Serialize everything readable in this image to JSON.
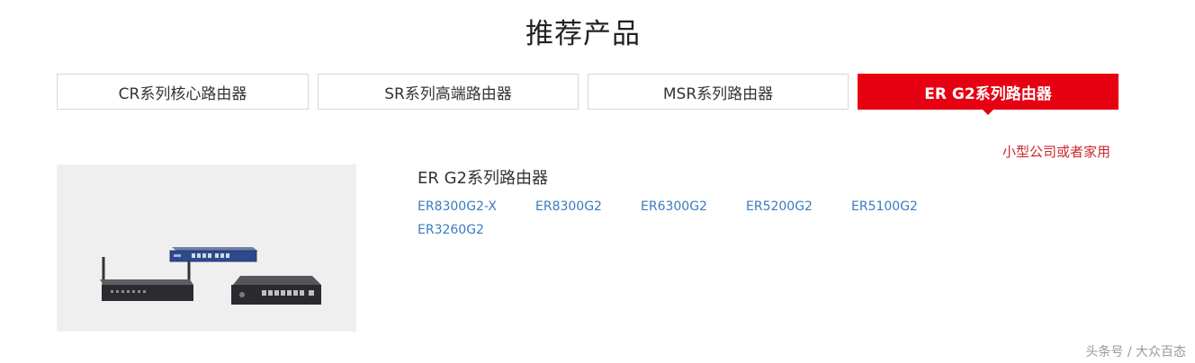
{
  "section": {
    "title": "推荐产品"
  },
  "tabs": [
    {
      "label": "CR系列核心路由器",
      "active": false
    },
    {
      "label": "SR系列高端路由器",
      "active": false
    },
    {
      "label": "MSR系列路由器",
      "active": false
    },
    {
      "label": "ER G2系列路由器",
      "active": true
    }
  ],
  "active_tab_subtitle": "小型公司或者家用",
  "product": {
    "series_title": "ER G2系列路由器",
    "models": [
      "ER8300G2-X",
      "ER8300G2",
      "ER6300G2",
      "ER5200G2",
      "ER5100G2",
      "ER3260G2"
    ]
  },
  "watermark": "头条号 / 大众百态",
  "colors": {
    "accent": "#e60012",
    "subtitle": "#c9292e",
    "link": "#3a7bbf",
    "image_bg": "#efefef"
  }
}
